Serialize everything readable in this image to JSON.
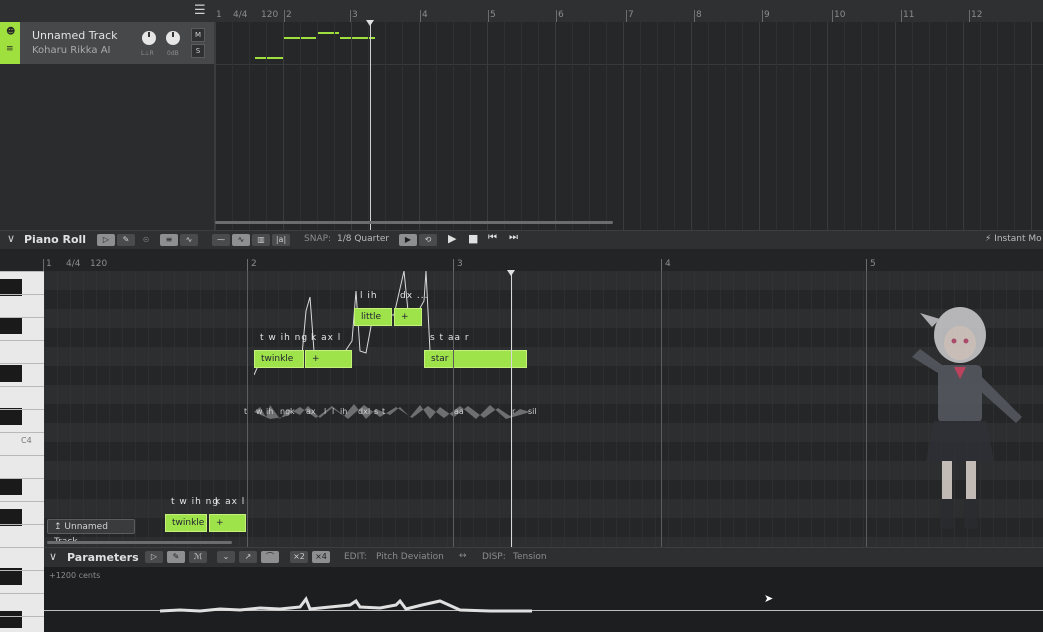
{
  "arrangement": {
    "menu_icon": "hamburger-icon",
    "ruler": {
      "time_sig": "4/4",
      "tempo": "120",
      "bars": [
        "1",
        "2",
        "3",
        "4",
        "5",
        "6",
        "7",
        "8",
        "9",
        "10",
        "11",
        "12"
      ]
    },
    "track": {
      "name": "Unnamed Track",
      "voice": "Koharu Rikka AI",
      "mute_label": "M",
      "solo_label": "S",
      "pan_label": "L⊥R",
      "gain_label": "0dB",
      "color": "#9fe03f"
    }
  },
  "piano_roll": {
    "title": "Piano Roll",
    "snap_label": "SNAP:",
    "snap_value": "1/8 Quarter",
    "instant_mode_label": "⚡ Instant Mo",
    "ruler": {
      "time_sig": "4/4",
      "tempo": "120",
      "bars": [
        "1",
        "2",
        "3",
        "4",
        "5"
      ]
    },
    "key_label": "C4",
    "notes": [
      {
        "lyric": "twinkle",
        "phonemes": "t w ih ng"
      },
      {
        "lyric": "+",
        "phonemes": "k ax l"
      },
      {
        "lyric": "little",
        "phonemes": "l ih"
      },
      {
        "lyric": "+",
        "phonemes": "dx ..."
      },
      {
        "lyric": "star",
        "phonemes": "s t aa r"
      }
    ],
    "waveform_phonemes": [
      "t",
      "w",
      "ih",
      "ng",
      "k",
      "ax",
      "l",
      "l",
      "ih",
      "dx",
      "l",
      "s",
      "t",
      "aa",
      "r",
      "sil"
    ],
    "ghost_notes": [
      {
        "lyric": "twinkle",
        "phonemes": "t w ih ng"
      },
      {
        "lyric": "+",
        "phonemes": "k ax l"
      }
    ],
    "track_tag": "↥ Unnamed Track"
  },
  "parameters": {
    "title": "Parameters",
    "edit_label": "EDIT:",
    "edit_value": "Pitch Deviation",
    "disp_label": "DISP:",
    "disp_value": "Tension",
    "swap_icon": "↔",
    "range_label": "+1200 cents",
    "zoom_x2": "×2",
    "zoom_x4": "×4"
  },
  "colors": {
    "accent": "#9fe03f",
    "note_fill": "#9fe34a",
    "background": "#1e1f20"
  }
}
